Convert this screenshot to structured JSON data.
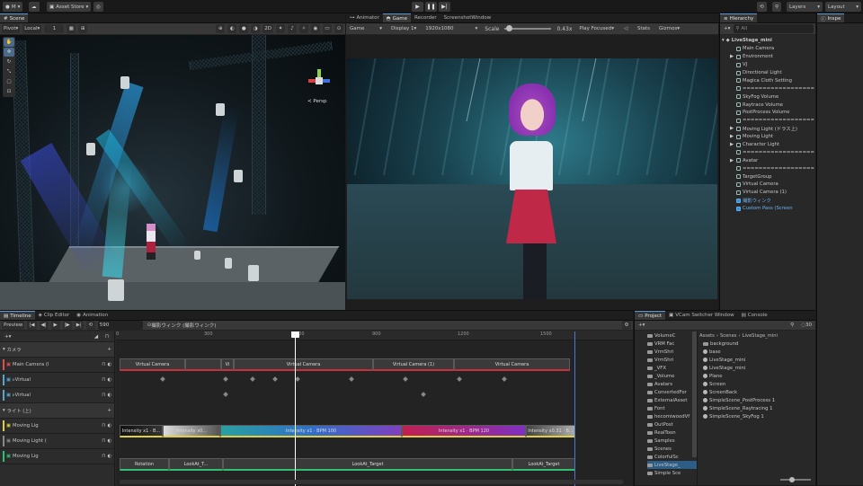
{
  "topbar": {
    "account": "M",
    "asset_store": "Asset Store",
    "layers": "Layers",
    "layout": "Layout"
  },
  "scene": {
    "tab": "Scene",
    "pivot": "Pivot",
    "local": "Local",
    "grid_num": "1",
    "mode_2d": "2D",
    "persp_label": "≺ Persp"
  },
  "game": {
    "tabs": [
      "Animator",
      "Game",
      "Recorder",
      "ScreenshotWindow"
    ],
    "view": "Game",
    "display": "Display 1",
    "resolution": "1920x1080",
    "scale_label": "Scale",
    "scale_value": "0.43x",
    "play_mode": "Play Focused",
    "stats": "Stats",
    "gizmos": "Gizmos"
  },
  "hierarchy": {
    "tab": "Hierarchy",
    "search_placeholder": "All",
    "inspector_tab": "Inspe",
    "root": "LiveStage_mini",
    "items": [
      {
        "label": "Main Camera",
        "indent": 1,
        "arrow": ""
      },
      {
        "label": "Environment",
        "indent": 1,
        "arrow": "▶"
      },
      {
        "label": "VJ",
        "indent": 1,
        "arrow": ""
      },
      {
        "label": "Directional Light",
        "indent": 1,
        "arrow": ""
      },
      {
        "label": "Magica Cloth Setting",
        "indent": 1,
        "arrow": ""
      },
      {
        "label": "==================",
        "indent": 1,
        "arrow": ""
      },
      {
        "label": "SkyFog Volume",
        "indent": 1,
        "arrow": ""
      },
      {
        "label": "Raytrace Volume",
        "indent": 1,
        "arrow": ""
      },
      {
        "label": "PostProcess Volume",
        "indent": 1,
        "arrow": ""
      },
      {
        "label": "==================",
        "indent": 1,
        "arrow": ""
      },
      {
        "label": "Moving Light (ドラス上)",
        "indent": 1,
        "arrow": "▶"
      },
      {
        "label": "Moving Light",
        "indent": 1,
        "arrow": "▶"
      },
      {
        "label": "Character Light",
        "indent": 1,
        "arrow": "▶"
      },
      {
        "label": "==================",
        "indent": 1,
        "arrow": ""
      },
      {
        "label": "Avatar",
        "indent": 1,
        "arrow": "▶"
      },
      {
        "label": "==================",
        "indent": 1,
        "arrow": ""
      },
      {
        "label": "TargetGroup",
        "indent": 1,
        "arrow": ""
      },
      {
        "label": "Virtual Camera",
        "indent": 1,
        "arrow": ""
      },
      {
        "label": "Virtual Camera (1)",
        "indent": 1,
        "arrow": ""
      },
      {
        "label": "撮影ウィンク",
        "indent": 1,
        "arrow": "",
        "prefab": true
      },
      {
        "label": "Custom Pass (Screen",
        "indent": 1,
        "arrow": "",
        "prefab": true
      }
    ]
  },
  "timeline": {
    "tabs": [
      "Timeline",
      "Clip Editor",
      "Animation"
    ],
    "preview": "Preview",
    "frame": "590",
    "asset_name": "撮影ウィンク (撮影ウィンク)",
    "ruler": [
      "0",
      "300",
      "600",
      "900",
      "1200",
      "1500"
    ],
    "groups": [
      {
        "label": "カメラ"
      },
      {
        "label": "ライト (上)"
      }
    ],
    "tracks": [
      {
        "label": "Main Camera (I",
        "color": "#e05050",
        "row": 1
      },
      {
        "label": "▹Virtual",
        "color": "#5aa5d0",
        "row": 2
      },
      {
        "label": "▹Virtual",
        "color": "#5aa5d0",
        "row": 3
      },
      {
        "label": "Moving Lig",
        "color": "#e0d040",
        "row": 5
      },
      {
        "label": "Moving Light (",
        "color": "#888888",
        "row": 6
      },
      {
        "label": "Moving Lig",
        "color": "#30c070",
        "row": 7
      }
    ],
    "camera_clips": [
      "Virtual Camera",
      "Vi",
      "Virtual Camera",
      "Virtual Camera (1)",
      "Virtual Camera"
    ],
    "light_clips": [
      "Intensity x1 · B...",
      "Intensity x0...",
      "Intensity x1 · BPM 100",
      "Intensity x1 · BPM 120",
      "Intensity x0.31 · B..."
    ],
    "rotation_clips": [
      "Rotation",
      "LookAt_T...",
      "LookAt_Target",
      "LookAt_Target"
    ]
  },
  "project": {
    "tabs": [
      "Project",
      "VCam Switcher Window",
      "Console"
    ],
    "count": "30",
    "breadcrumb": [
      "Assets",
      "Scenes",
      "LiveStage_mini"
    ],
    "tree": [
      "VolumeC",
      "VRM Fac",
      "VrmShri",
      "VrmShri",
      "_VFX",
      "_Volume",
      "Avatars",
      "ConvertedFor",
      "ExternalAsset",
      "Font",
      "hecomiwoodVf",
      "OutPost",
      "RealToon",
      "Samples",
      "Scenes",
      "ColorfulSc",
      "LiveStage_",
      "Simple Sce"
    ],
    "files": [
      {
        "label": "background",
        "type": "folder"
      },
      {
        "label": "base",
        "type": "scene"
      },
      {
        "label": "LiveStage_mini",
        "type": "scene"
      },
      {
        "label": "LiveStage_mini",
        "type": "scene"
      },
      {
        "label": "Plane",
        "type": "scene"
      },
      {
        "label": "Screen",
        "type": "scene"
      },
      {
        "label": "ScreenBack",
        "type": "scene"
      },
      {
        "label": "SimpleScene_PostProcess 1",
        "type": "scene"
      },
      {
        "label": "SimpleScene_Raytracing 1",
        "type": "scene"
      },
      {
        "label": "SimpleScene_SkyFog 1",
        "type": "scene"
      }
    ]
  },
  "colors": {
    "accent": "#5a9bd8",
    "playhead": "#ffffff",
    "selected": "#2c5d87"
  }
}
